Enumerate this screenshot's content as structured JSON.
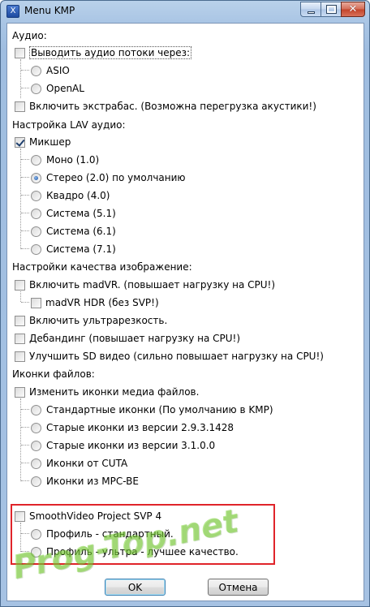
{
  "window": {
    "title": "Menu KMP",
    "icon_glyph": "X",
    "close_glyph": "✕"
  },
  "audio": {
    "section_label": "Аудио:",
    "output_streams": {
      "label": "Выводить аудио потоки через:",
      "checked": false
    },
    "asio": {
      "label": "ASIO",
      "selected": false
    },
    "openal": {
      "label": "OpenAL",
      "selected": false
    },
    "extrabass": {
      "label": "Включить экстрабас. (Возможна перегрузка акустики!)",
      "checked": false
    }
  },
  "lav_audio": {
    "section_label": "Настройка LAV аудио:",
    "mixer": {
      "label": "Микшер",
      "checked": true
    },
    "options": [
      {
        "label": "Моно (1.0)",
        "selected": false
      },
      {
        "label": "Стерео (2.0) по умолчанию",
        "selected": true
      },
      {
        "label": "Квадро (4.0)",
        "selected": false
      },
      {
        "label": "Система (5.1)",
        "selected": false
      },
      {
        "label": "Система (6.1)",
        "selected": false
      },
      {
        "label": "Система (7.1)",
        "selected": false
      }
    ]
  },
  "image_quality": {
    "section_label": "Настройки качества изображение:",
    "madvr": {
      "label": "Включить madVR. (повышает нагрузку на CPU!)",
      "checked": false
    },
    "madvr_hdr": {
      "label": "madVR HDR (без SVP!)",
      "checked": false
    },
    "ultra_sharp": {
      "label": "Включить ультрарезкость.",
      "checked": false
    },
    "debanding": {
      "label": "Дебандинг (повышает нагрузку на CPU!)",
      "checked": false
    },
    "improve_sd": {
      "label": "Улучшить SD видео (сильно повышает нагрузку на CPU!)",
      "checked": false
    }
  },
  "file_icons": {
    "section_label": "Иконки файлов:",
    "change_icons": {
      "label": "Изменить иконки медиа файлов.",
      "checked": false
    },
    "options": [
      {
        "label": "Стандартные иконки (По умолчанию в KMP)",
        "selected": false
      },
      {
        "label": "Старые иконки из версии 2.9.3.1428",
        "selected": false
      },
      {
        "label": "Старые иконки из версии 3.1.0.0",
        "selected": false
      },
      {
        "label": "Иконки от CUTA",
        "selected": false
      },
      {
        "label": "Иконки из MPC-BE",
        "selected": false
      }
    ]
  },
  "svp": {
    "enable": {
      "label": "SmoothVideo Project SVP 4",
      "checked": false
    },
    "profile_standard": {
      "label": "Профиль - стандартный.",
      "selected": false
    },
    "profile_ultra": {
      "label": "Профиль - ультра - лучшее качество.",
      "selected": false
    }
  },
  "watermark": {
    "text": "Prog-Top.net"
  },
  "buttons": {
    "ok": "OK",
    "cancel": "Отмена"
  }
}
